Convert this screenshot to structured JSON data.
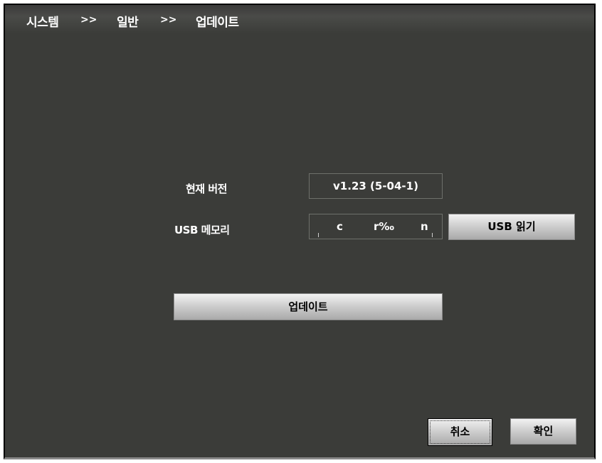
{
  "breadcrumb": {
    "items": [
      "시스템",
      "일반",
      "업데이트"
    ],
    "separator": ">>"
  },
  "form": {
    "current_version_label": "현재 버전",
    "current_version_value": "v1.23 (5-04-1)",
    "usb_memory_label": "USB 메모리",
    "usb_memory_segments": [
      "c",
      "r‰",
      "n"
    ],
    "usb_read_button": "USB 읽기",
    "update_button": "업데이트"
  },
  "footer": {
    "cancel_button": "취소",
    "confirm_button": "확인"
  },
  "colors": {
    "background": "#3b3c39",
    "text": "#ffffff",
    "button_face": "#cfcfcf"
  }
}
